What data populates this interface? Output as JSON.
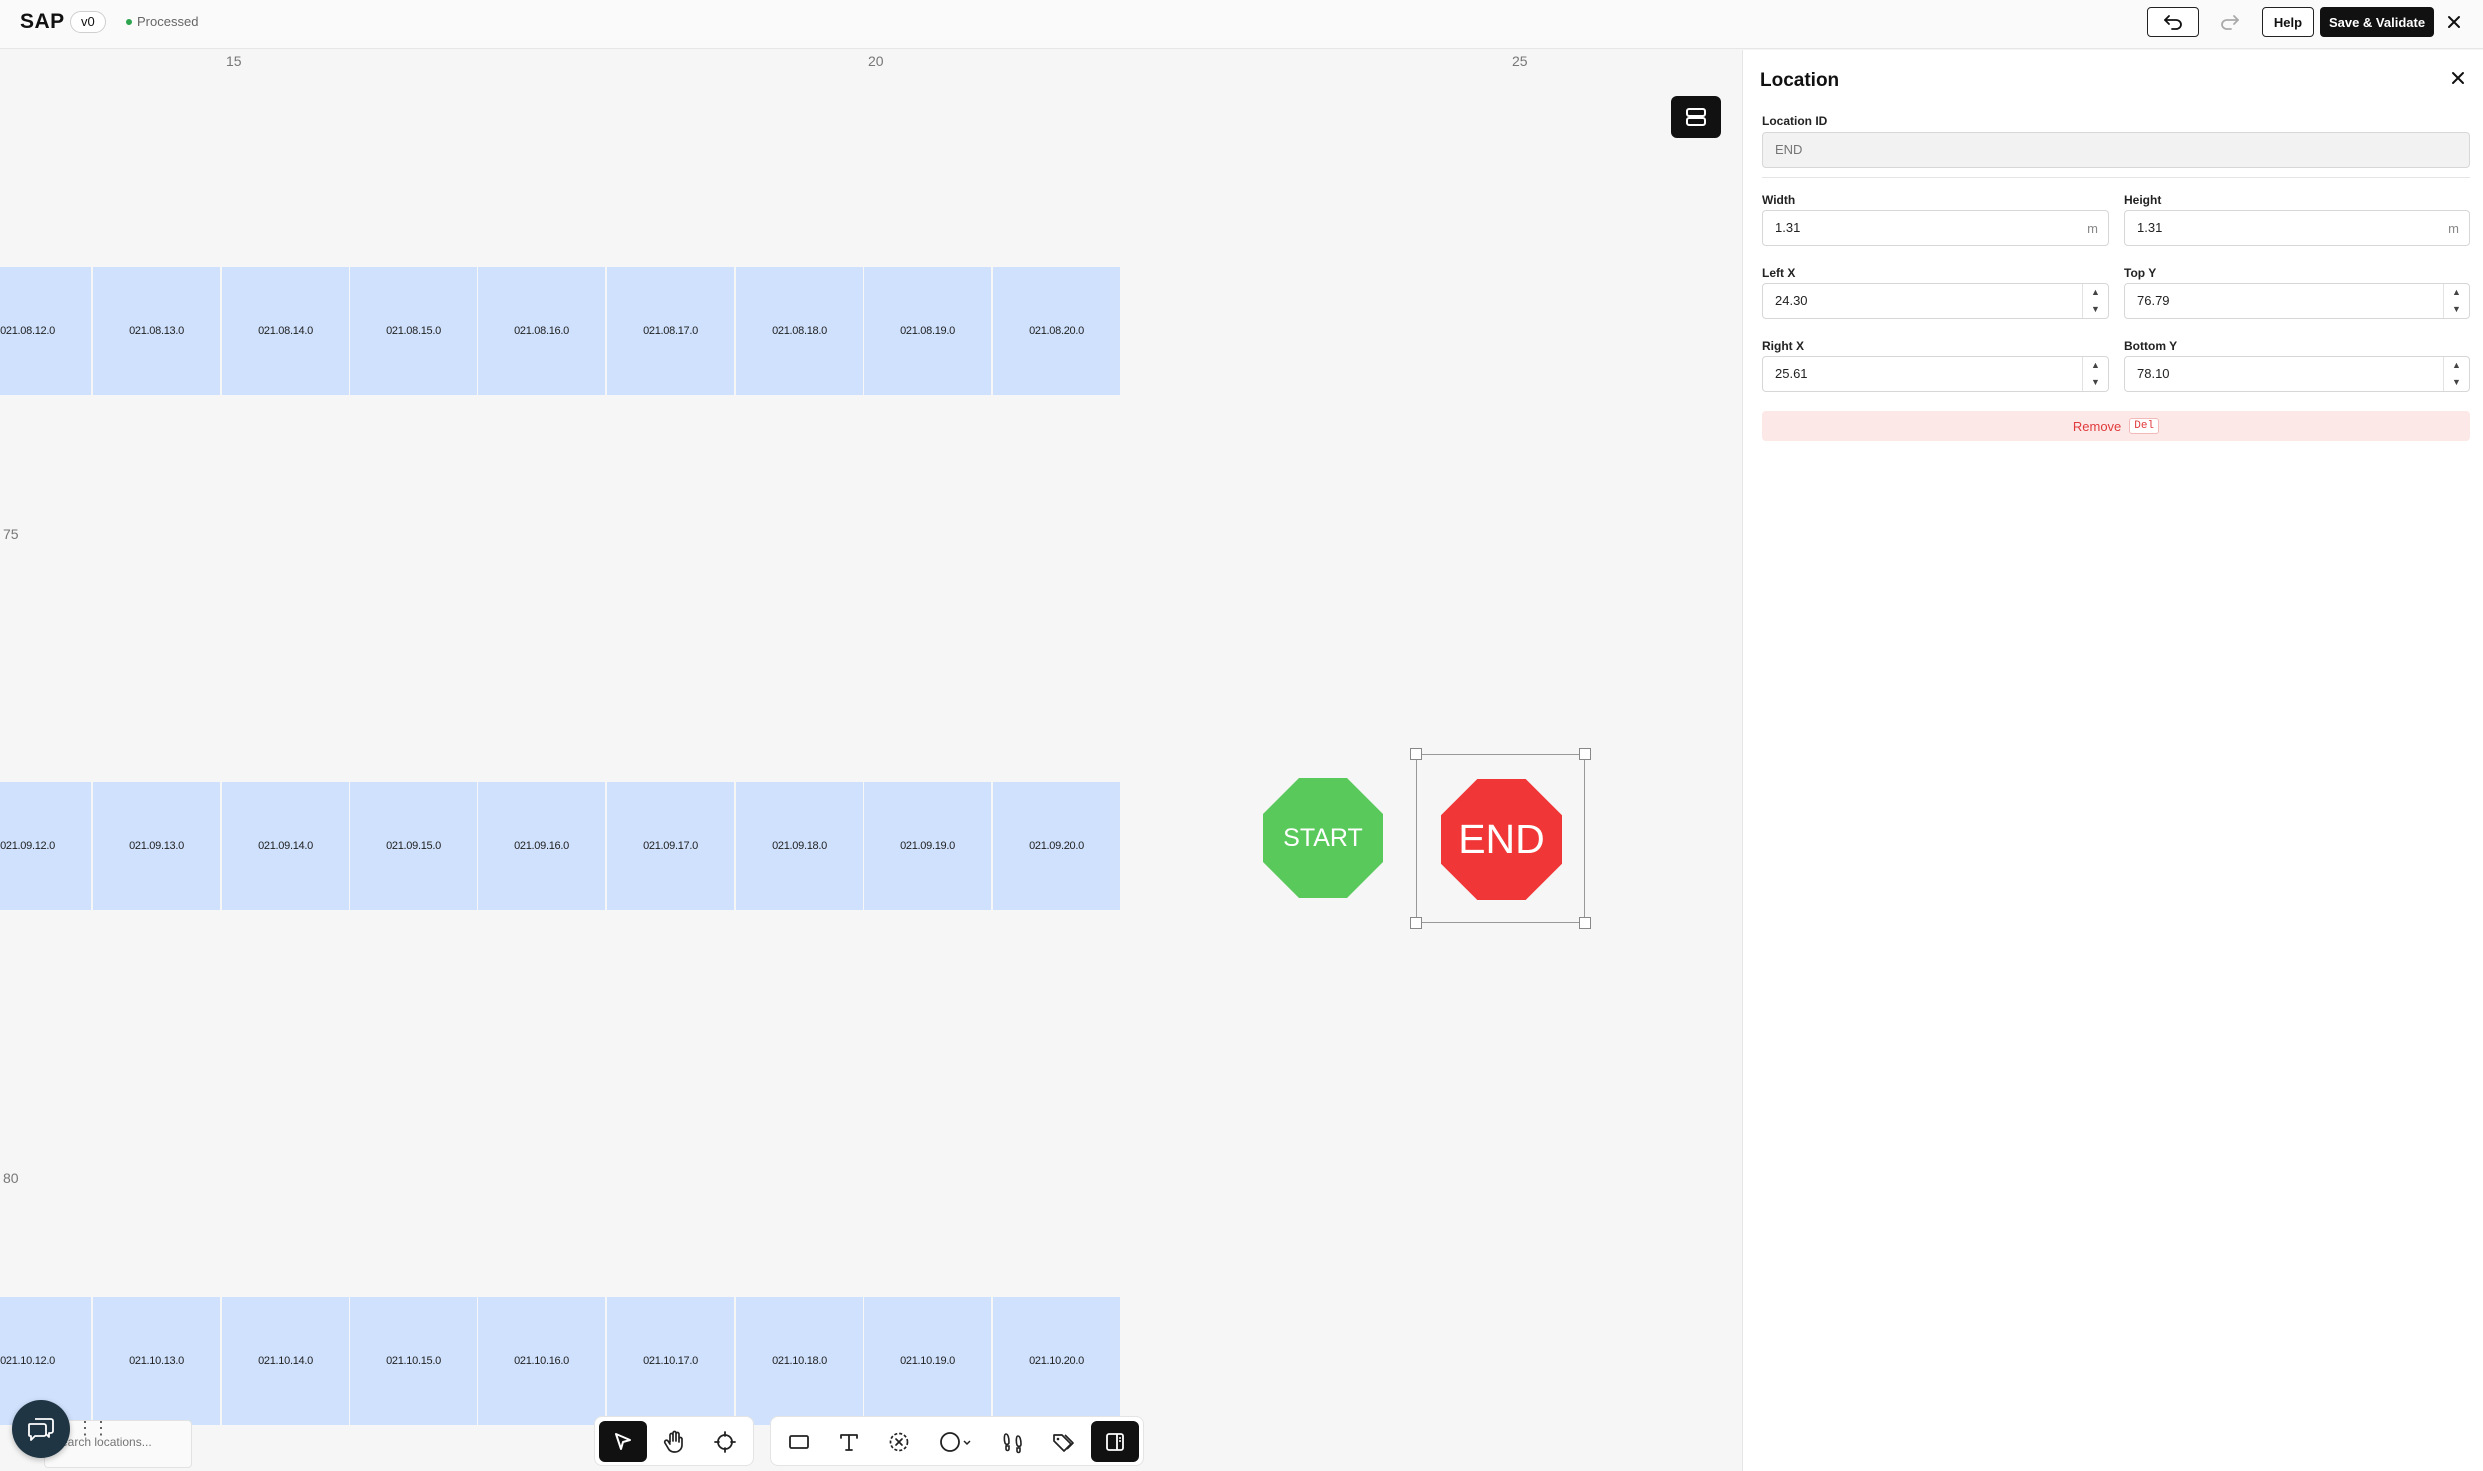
{
  "app": {
    "name": "SAP",
    "version": "v0",
    "status": "Processed"
  },
  "header": {
    "help_label": "Help",
    "save_label": "Save & Validate",
    "undo_icon": "undo-icon",
    "redo_icon": "redo-icon",
    "close_icon": "close-icon"
  },
  "canvas": {
    "ruler_x": [
      "15",
      "20",
      "25"
    ],
    "ruler_y": [
      "75",
      "80"
    ],
    "rows": [
      [
        "021.08.12.0",
        "021.08.13.0",
        "021.08.14.0",
        "021.08.15.0",
        "021.08.16.0",
        "021.08.17.0",
        "021.08.18.0",
        "021.08.19.0",
        "021.08.20.0"
      ],
      [
        "021.09.12.0",
        "021.09.13.0",
        "021.09.14.0",
        "021.09.15.0",
        "021.09.16.0",
        "021.09.17.0",
        "021.09.18.0",
        "021.09.19.0",
        "021.09.20.0"
      ],
      [
        "021.10.12.0",
        "021.10.13.0",
        "021.10.14.0",
        "021.10.15.0",
        "021.10.16.0",
        "021.10.17.0",
        "021.10.18.0",
        "021.10.19.0",
        "021.10.20.0"
      ]
    ],
    "start_label": "START",
    "end_label": "END",
    "colors": {
      "location": "#cfe1fd",
      "start": "#58c95a",
      "end": "#f03636"
    }
  },
  "search": {
    "placeholder": "Search locations..."
  },
  "toolbar": {
    "tools": [
      "select-tool",
      "pan-tool",
      "target-tool",
      "rectangle-tool",
      "text-tool",
      "exclusion-tool",
      "circle-tool",
      "footsteps-tool",
      "tag-tool",
      "panel-toggle"
    ]
  },
  "panel": {
    "title": "Location",
    "location_id_label": "Location ID",
    "location_id_value": "END",
    "width_label": "Width",
    "width_value": "1.31",
    "height_label": "Height",
    "height_value": "1.31",
    "unit": "m",
    "left_x_label": "Left X",
    "left_x_value": "24.30",
    "top_y_label": "Top Y",
    "top_y_value": "76.79",
    "right_x_label": "Right X",
    "right_x_value": "25.61",
    "bottom_y_label": "Bottom Y",
    "bottom_y_value": "78.10",
    "remove_label": "Remove",
    "remove_shortcut": "Del"
  }
}
